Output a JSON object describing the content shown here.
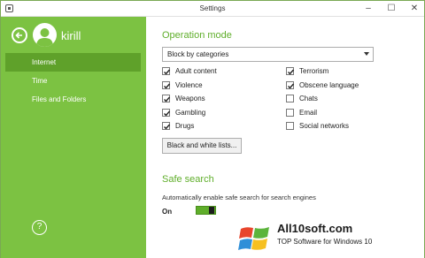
{
  "window": {
    "title": "Settings",
    "minimize": "–",
    "maximize": "☐",
    "close": "✕"
  },
  "sidebar": {
    "user_name": "kirill",
    "items": [
      {
        "label": "Internet",
        "selected": true
      },
      {
        "label": "Time",
        "selected": false
      },
      {
        "label": "Files and Folders",
        "selected": false
      }
    ],
    "help": "?"
  },
  "operation_mode": {
    "title": "Operation mode",
    "mode_select": "Block by categories",
    "categories": [
      {
        "label": "Adult content",
        "checked": true
      },
      {
        "label": "Violence",
        "checked": true
      },
      {
        "label": "Weapons",
        "checked": true
      },
      {
        "label": "Gambling",
        "checked": true
      },
      {
        "label": "Drugs",
        "checked": true
      },
      {
        "label": "Terrorism",
        "checked": true
      },
      {
        "label": "Obscene language",
        "checked": true
      },
      {
        "label": "Chats",
        "checked": false
      },
      {
        "label": "Email",
        "checked": false
      },
      {
        "label": "Social networks",
        "checked": false
      }
    ],
    "lists_button": "Black and white lists..."
  },
  "safe_search": {
    "title": "Safe search",
    "description": "Automatically enable safe search for search engines",
    "toggle_label": "On",
    "enabled": true
  },
  "watermark": {
    "site": "All10soft.com",
    "tagline": "TOP Software for Windows 10"
  },
  "colors": {
    "accent": "#7cc242",
    "accent_dark": "#5fa12a",
    "title_green": "#5fae2a"
  }
}
